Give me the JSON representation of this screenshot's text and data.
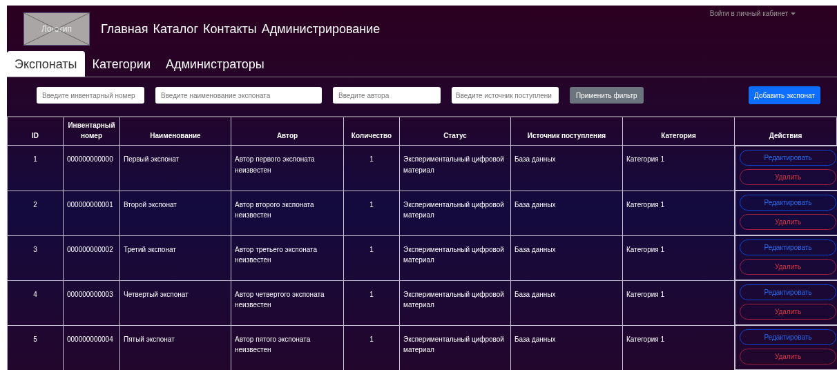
{
  "header": {
    "logo": "Логотип",
    "nav": [
      "Главная",
      "Каталог",
      "Контакты",
      "Администрирование"
    ],
    "account": "Войти в личный кабинет"
  },
  "tabs": [
    {
      "label": "Экспонаты",
      "selected": true
    },
    {
      "label": "Категории",
      "selected": false
    },
    {
      "label": "Администраторы",
      "selected": false
    }
  ],
  "filters": [
    {
      "placeholder": "Введите инвентарный номер"
    },
    {
      "placeholder": "Введите наименование экспоната"
    },
    {
      "placeholder": "Введите автора"
    },
    {
      "placeholder": "Введите источник поступлени"
    }
  ],
  "apply_button": "Применить фильтр",
  "add_button": "Добавить экспонат",
  "table": {
    "columns": [
      "ID",
      "Инвентарный номер",
      "Наименование",
      "Автор",
      "Количество",
      "Статус",
      "Источник поступления",
      "Категория",
      "Действия"
    ],
    "rows": [
      {
        "id": "1",
        "number": "000000000000",
        "name": "Первый экспонат",
        "author": "Автор первого экспоната неизвестен",
        "count": "1",
        "status": "Экспериментальный цифровой материал",
        "source": "База данных",
        "category": "Категория 1",
        "edit": "Редактировать",
        "delete": "Удалить"
      },
      {
        "id": "2",
        "number": "000000000001",
        "name": "Второй экспонат",
        "author": "Автор второго экспоната неизвестен",
        "count": "1",
        "status": "Экспериментальный цифровой материал",
        "source": "База данных",
        "category": "Категория 1",
        "edit": "Редактировать",
        "delete": "Удалить"
      },
      {
        "id": "3",
        "number": "000000000002",
        "name": "Третий экспонат",
        "author": "Автор третьего экспоната неизвестен",
        "count": "1",
        "status": "Экспериментальный цифровой материал",
        "source": "База данных",
        "category": "Категория 1",
        "edit": "Редактировать",
        "delete": "Удалить"
      },
      {
        "id": "4",
        "number": "000000000003",
        "name": "Четвертый экспонат",
        "author": "Автор четвертого экспоната неизвестен",
        "count": "1",
        "status": "Экспериментальный цифровой материал",
        "source": "База данных",
        "category": "Категория 1",
        "edit": "Редактировать",
        "delete": "Удалить"
      },
      {
        "id": "5",
        "number": "000000000004",
        "name": "Пятый экспонат",
        "author": "Автор пятого экспоната неизвестен",
        "count": "1",
        "status": "Экспериментальный цифровой материал",
        "source": "База данных",
        "category": "Категория 1",
        "edit": "Редактировать",
        "delete": "Удалить"
      }
    ]
  }
}
